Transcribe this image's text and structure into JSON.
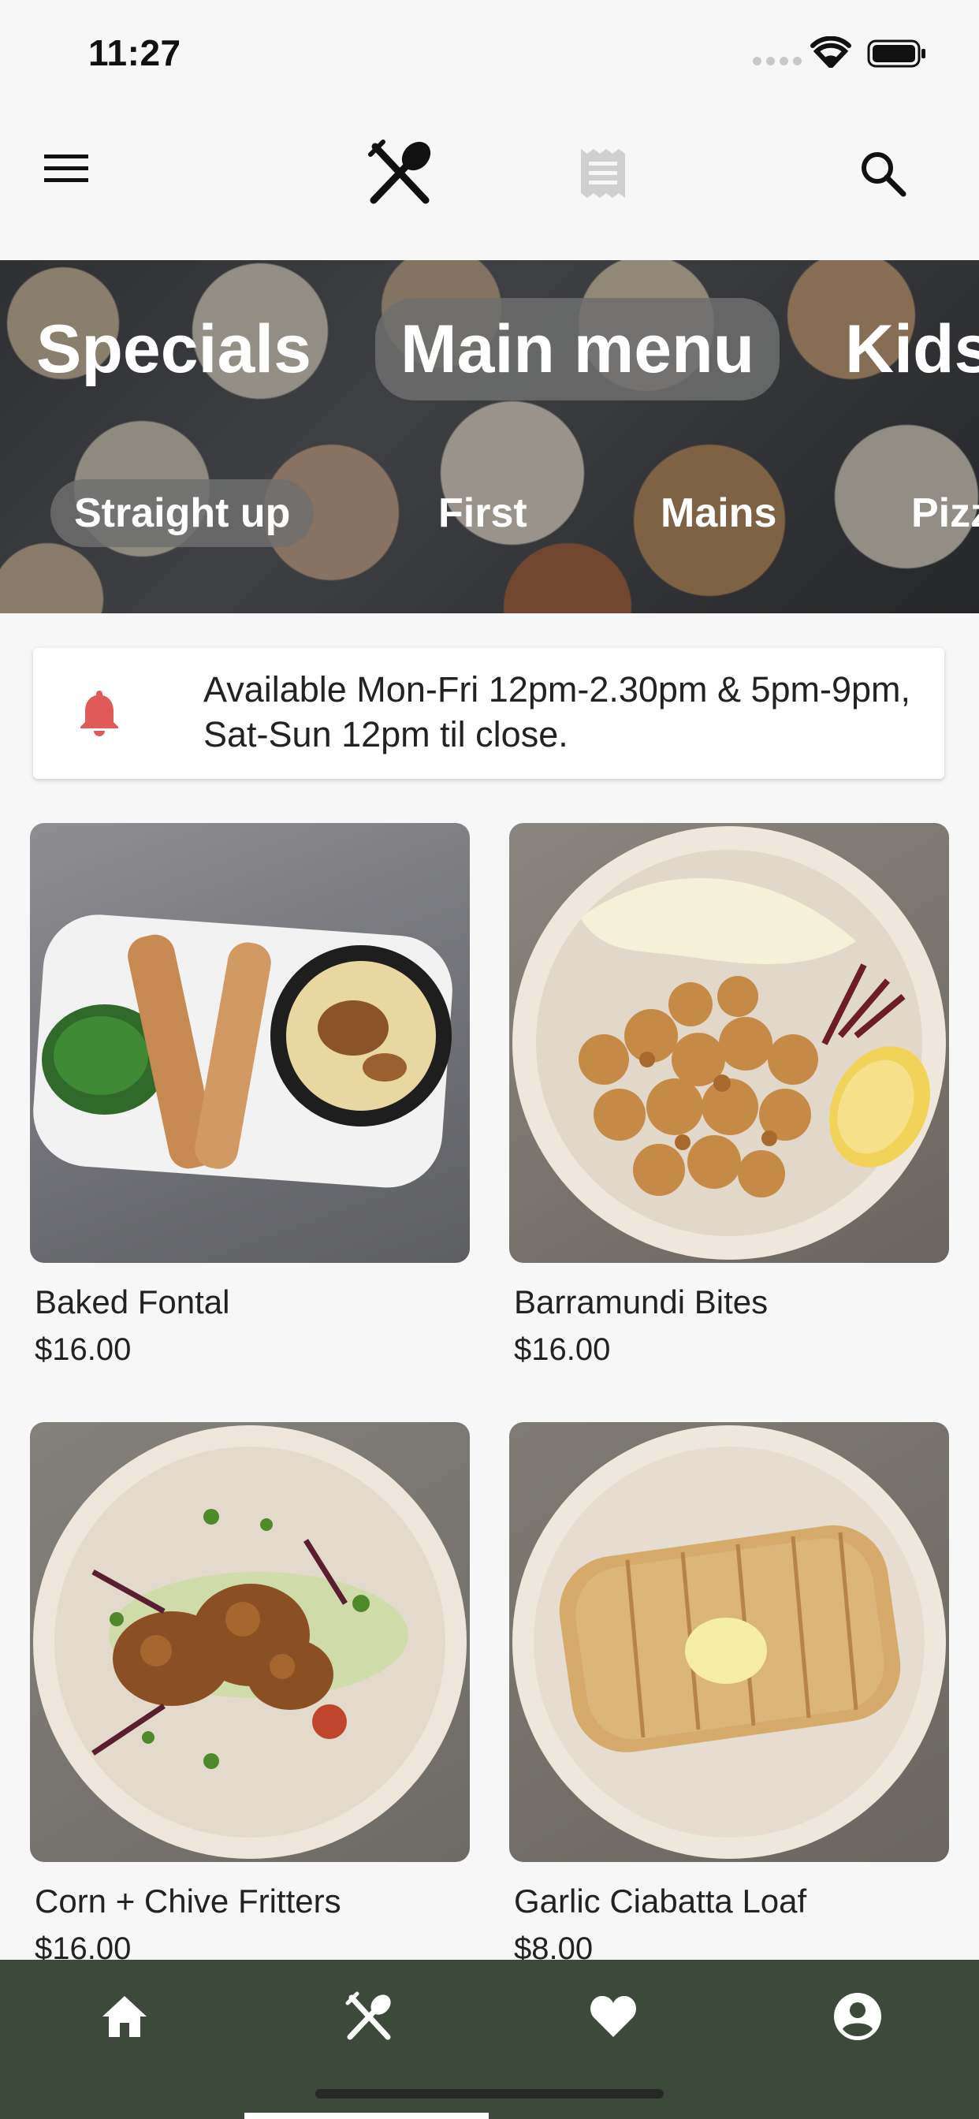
{
  "status_bar": {
    "time": "11:27"
  },
  "app_bar": {
    "menu_icon": "menu-icon",
    "center_icon": "cutlery-icon",
    "receipt_icon": "receipt-icon",
    "search_icon": "search-icon"
  },
  "categories": [
    {
      "label": "Specials",
      "selected": false
    },
    {
      "label": "Main menu",
      "selected": true
    },
    {
      "label": "Kids",
      "selected": false
    }
  ],
  "subcategories": [
    {
      "label": "Straight up",
      "selected": true
    },
    {
      "label": "First",
      "selected": false
    },
    {
      "label": "Mains",
      "selected": false
    },
    {
      "label": "Pizza",
      "selected": false
    }
  ],
  "notice": {
    "icon": "bell-icon",
    "text": "Available Mon-Fri 12pm-2.30pm & 5pm-9pm, Sat-Sun 12pm til close."
  },
  "items": [
    {
      "name": "Baked Fontal",
      "price": "$16.00"
    },
    {
      "name": "Barramundi Bites",
      "price": "$16.00"
    },
    {
      "name": "Corn + Chive Fritters",
      "price": "$16.00"
    },
    {
      "name": "Garlic Ciabatta Loaf",
      "price": "$8.00"
    }
  ],
  "bottom_nav": {
    "items": [
      {
        "icon": "home-icon",
        "selected": false
      },
      {
        "icon": "cutlery-icon",
        "selected": true
      },
      {
        "icon": "heart-icon",
        "selected": false
      },
      {
        "icon": "account-icon",
        "selected": false
      }
    ]
  },
  "colors": {
    "nav_background": "#3d4a3b",
    "bell": "#e05a5a",
    "selected_pill": "#6e6e6e"
  }
}
